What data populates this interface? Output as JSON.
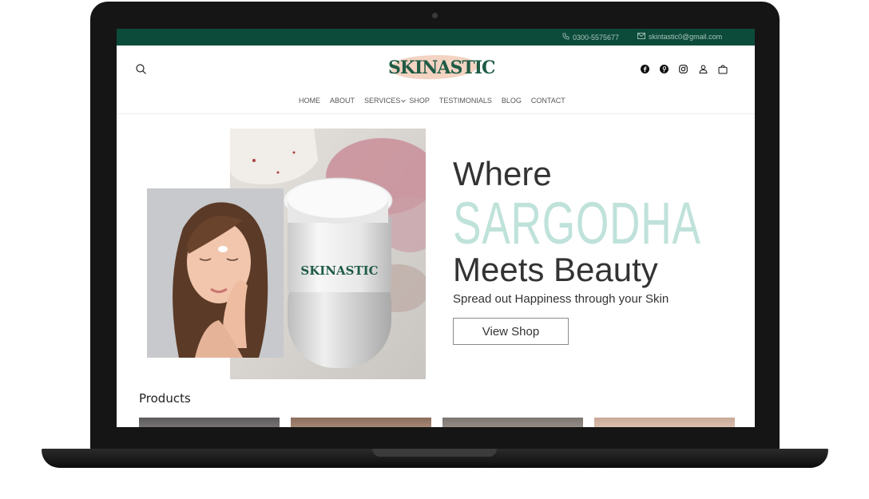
{
  "topbar": {
    "phone": "0300-5575677",
    "email": "skintastic0@gmail.com"
  },
  "brand": {
    "logo_text": "SKINASTIC",
    "jar_label": "SKINASTIC"
  },
  "nav": {
    "items": [
      "HOME",
      "ABOUT",
      "SERVICES",
      "SHOP",
      "TESTIMONIALS",
      "BLOG",
      "CONTACT"
    ]
  },
  "header_icons": [
    "search-icon",
    "facebook-icon",
    "pinterest-icon",
    "instagram-icon",
    "user-icon",
    "cart-icon"
  ],
  "hero": {
    "line1": "Where",
    "line2": "SARGODHA",
    "line3": "Meets Beauty",
    "tagline": "Spread out Happiness through your Skin",
    "button": "View Shop"
  },
  "products": {
    "title": "Products"
  },
  "colors": {
    "topbar": "#0c4a3a",
    "brand_green": "#1f5b45",
    "accent_mint": "#bfe2da",
    "logo_blush": "#f3d3c2"
  }
}
